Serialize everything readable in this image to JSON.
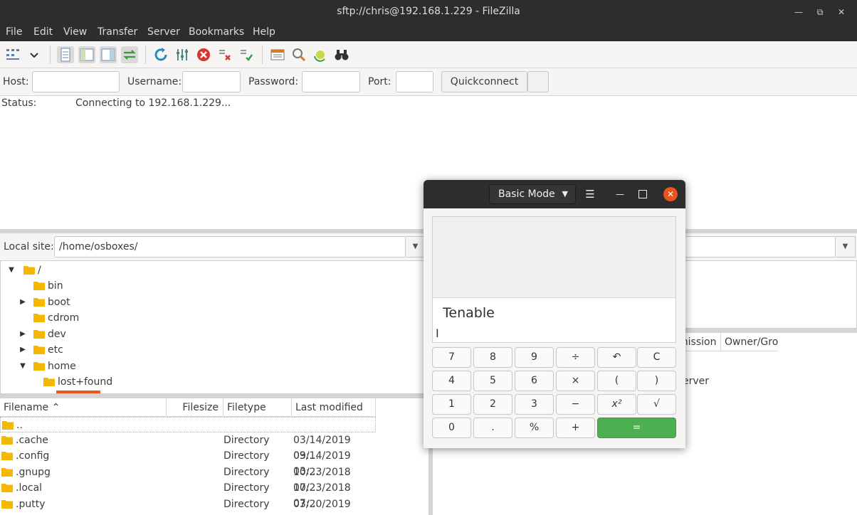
{
  "window": {
    "title": "sftp://chris@192.168.1.229 - FileZilla"
  },
  "menu": [
    "File",
    "Edit",
    "View",
    "Transfer",
    "Server",
    "Bookmarks",
    "Help"
  ],
  "quickconnect": {
    "host_label": "Host:",
    "username_label": "Username:",
    "password_label": "Password:",
    "port_label": "Port:",
    "button": "Quickconnect"
  },
  "log": {
    "status_label": "Status:",
    "status_text": "Connecting to 192.168.1.229..."
  },
  "local": {
    "label": "Local site:",
    "path": "/home/osboxes/",
    "tree": [
      {
        "name": "/",
        "expanded": true
      },
      {
        "name": "bin"
      },
      {
        "name": "boot"
      },
      {
        "name": "cdrom"
      },
      {
        "name": "dev"
      },
      {
        "name": "etc"
      },
      {
        "name": "home",
        "expanded": true
      },
      {
        "name": "lost+found"
      }
    ],
    "columns": [
      "Filename",
      "Filesize",
      "Filetype",
      "Last modified"
    ],
    "files": [
      {
        "name": "..",
        "type": "",
        "modified": ""
      },
      {
        "name": ".cache",
        "type": "Directory",
        "modified": "03/14/2019 09:..."
      },
      {
        "name": ".config",
        "type": "Directory",
        "modified": "03/14/2019 03:..."
      },
      {
        "name": ".gnupg",
        "type": "Directory",
        "modified": "10/23/2018 07:..."
      },
      {
        "name": ".local",
        "type": "Directory",
        "modified": "10/23/2018 07:..."
      },
      {
        "name": ".putty",
        "type": "Directory",
        "modified": "03/20/2019 02:..."
      }
    ]
  },
  "remote": {
    "columns_visible": [
      "mission",
      "Owner/Gro"
    ],
    "message": "erver"
  },
  "calculator": {
    "mode": "Basic Mode",
    "display": "Tenable",
    "keys": [
      [
        "7",
        "8",
        "9",
        "÷",
        "↶",
        "C"
      ],
      [
        "4",
        "5",
        "6",
        "×",
        "(",
        ")"
      ],
      [
        "1",
        "2",
        "3",
        "−",
        "x²",
        "√"
      ],
      [
        "0",
        ".",
        "%",
        "+",
        "="
      ]
    ]
  },
  "colors": {
    "folder": "#f5b800",
    "equals": "#4caf50",
    "close": "#e95420"
  }
}
